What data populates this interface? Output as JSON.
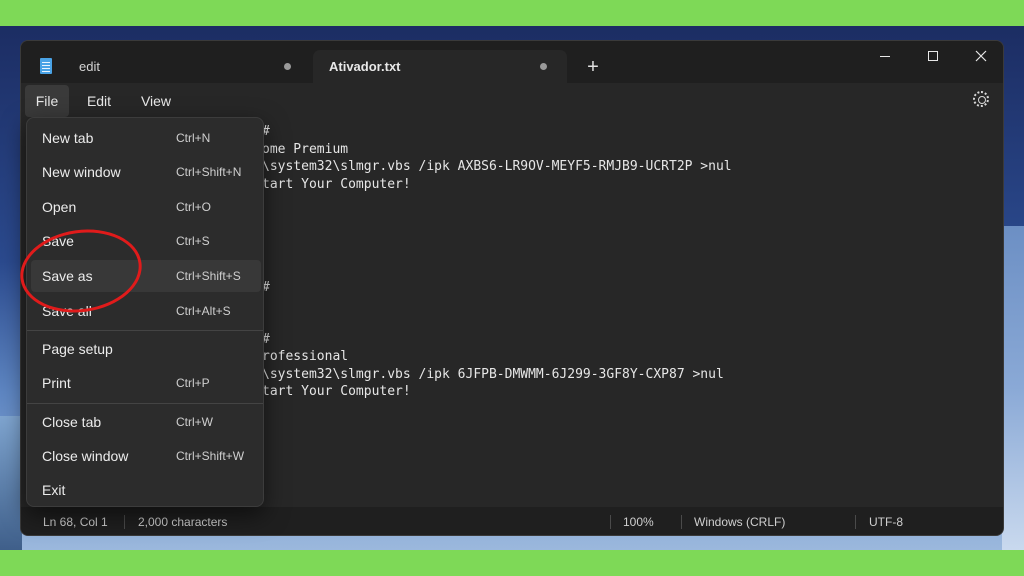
{
  "window": {
    "tabs": [
      {
        "label": "edit",
        "active": false
      },
      {
        "label": "Ativador.txt",
        "active": true
      }
    ],
    "new_tab_symbol": "+"
  },
  "menubar": {
    "file": "File",
    "edit": "Edit",
    "view": "View"
  },
  "editor": {
    "lines": [
      {
        "text": "#"
      },
      {
        "text": "ome Premium"
      },
      {
        "text": "\\system32\\slmgr.vbs /ipk AXBS6-LR9OV-MEYF5-RMJB9-UCRT2P >nul"
      },
      {
        "text": "tart Your Computer!"
      },
      {
        "text": "#"
      },
      {
        "text": "#"
      },
      {
        "text": "rofessional"
      },
      {
        "text": "\\system32\\slmgr.vbs /ipk 6JFPB-DMWMM-6J299-3GF8Y-CXP87 >nul"
      },
      {
        "text": "tart Your Computer!"
      }
    ]
  },
  "file_menu": {
    "items": [
      {
        "label": "New tab",
        "shortcut": "Ctrl+N"
      },
      {
        "label": "New window",
        "shortcut": "Ctrl+Shift+N"
      },
      {
        "label": "Open",
        "shortcut": "Ctrl+O"
      },
      {
        "label": "Save",
        "shortcut": "Ctrl+S"
      },
      {
        "label": "Save as",
        "shortcut": "Ctrl+Shift+S"
      },
      {
        "label": "Save all",
        "shortcut": "Ctrl+Alt+S"
      },
      {
        "label": "Page setup",
        "shortcut": ""
      },
      {
        "label": "Print",
        "shortcut": "Ctrl+P"
      },
      {
        "label": "Close tab",
        "shortcut": "Ctrl+W"
      },
      {
        "label": "Close window",
        "shortcut": "Ctrl+Shift+W"
      },
      {
        "label": "Exit",
        "shortcut": ""
      }
    ],
    "hovered_item": "Save as"
  },
  "statusbar": {
    "position": "Ln 68, Col 1",
    "characters": "2,000 characters",
    "zoom": "100%",
    "line_ending": "Windows (CRLF)",
    "encoding": "UTF-8"
  },
  "colors": {
    "annotation": "#e01b1b",
    "background": "#7ed957",
    "window": "#272727"
  }
}
